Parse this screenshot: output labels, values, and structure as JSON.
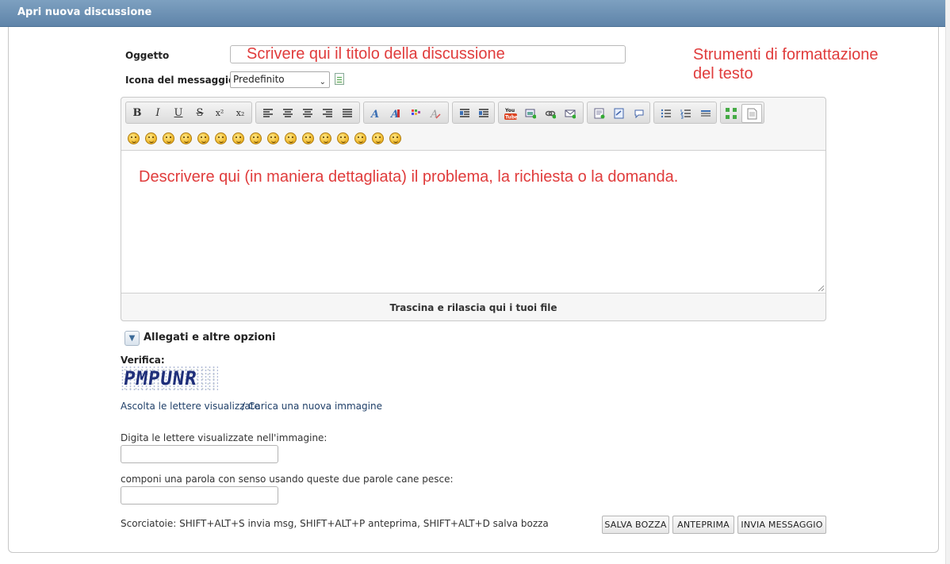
{
  "header": {
    "title": "Apri nuova discussione"
  },
  "form": {
    "subject_label": "Oggetto",
    "subject_value": "Scrivere qui il titolo della discussione",
    "icon_label": "Icona del messaggio",
    "icon_selected": "Predefinito"
  },
  "annotations": {
    "formatting_line1": "Strumenti di formattazione",
    "formatting_line2": "del testo"
  },
  "toolbar": {
    "bold": "B",
    "italic": "I",
    "underline": "U",
    "strike": "S",
    "superscript": "x²",
    "subscript": "x₂",
    "youtube": "You Tube"
  },
  "editor": {
    "body_text": "Descrivere qui (in maniera dettagliata) il problema, la richiesta o la domanda.",
    "dropzone_text": "Trascina e rilascia qui i tuoi file"
  },
  "options": {
    "label": "Allegati e altre opzioni"
  },
  "verification": {
    "label": "Verifica:",
    "captcha_text": "PMPUNR",
    "listen_link": "Ascolta le lettere visualizzate",
    "separator": "/",
    "reload_link": "Carica una nuova immagine",
    "type_letters_label": "Digita le lettere visualizzate nell'immagine:",
    "question_label": "componi una parola con senso usando queste due parole  cane pesce:"
  },
  "shortcuts": "Scorciatoie: SHIFT+ALT+S invia msg, SHIFT+ALT+P anteprima, SHIFT+ALT+D salva bozza",
  "buttons": {
    "save_draft": "SALVA BOZZA",
    "preview": "ANTEPRIMA",
    "send": "INVIA MESSAGGIO"
  },
  "colors": {
    "header_bg": "#6b8fb3",
    "annotation_red": "#e03c3c",
    "link_blue": "#1f3f68"
  }
}
